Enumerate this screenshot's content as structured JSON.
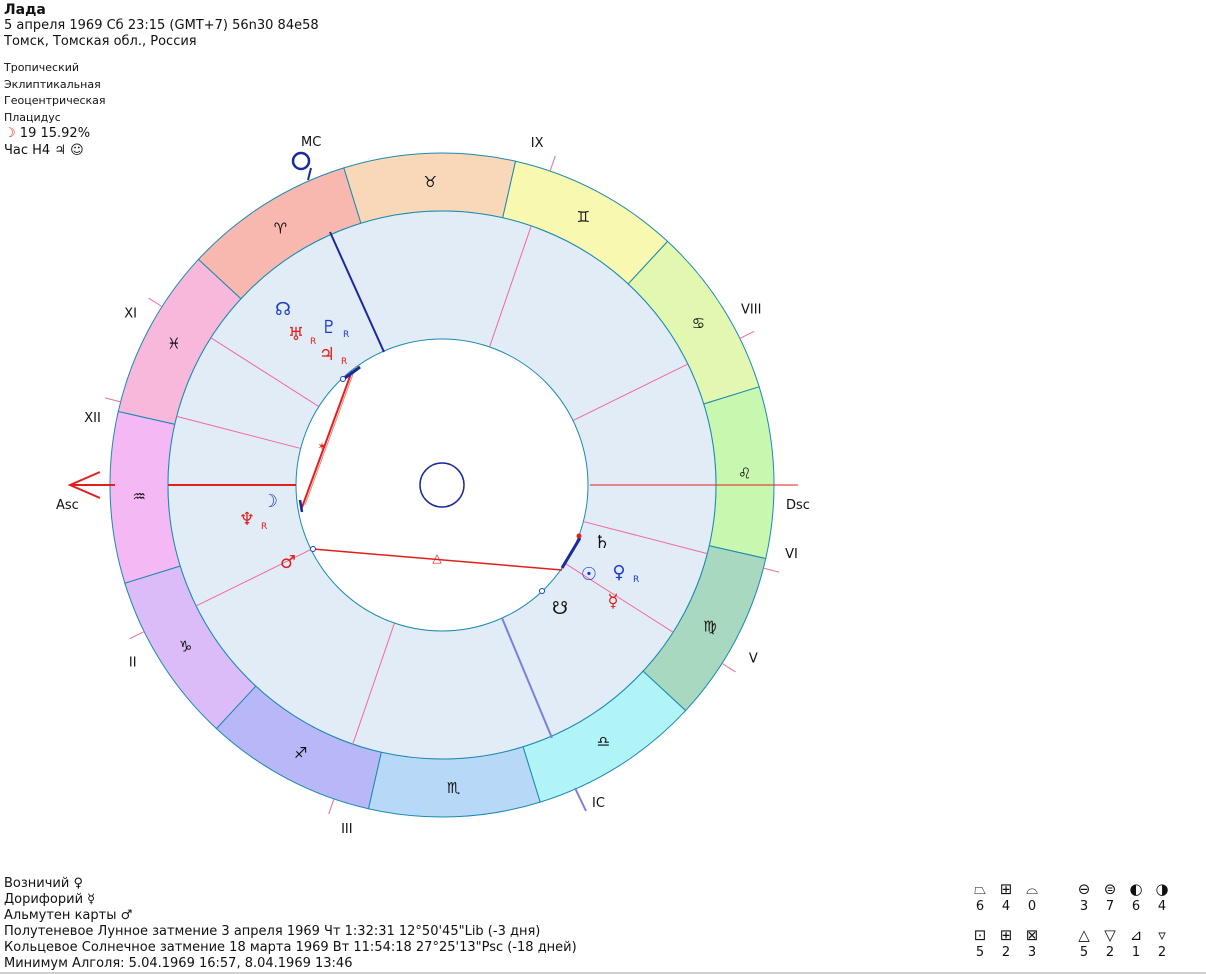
{
  "header": {
    "name": "Лада",
    "line1": "5 апреля 1969  Сб  23:15 (GMT+7) 56n30  84e58",
    "line2": "Томск, Томская обл., Россия"
  },
  "system": {
    "zodiac": "Тропический",
    "coords": "Эклиптикальная",
    "center": "Геоцентрическая",
    "houses": "Плацидус",
    "moon_glyph": "☽",
    "moon_info": "19 15.92%",
    "hour_label": "Час H4",
    "hour_glyphs": "♃ ☺"
  },
  "wheel": {
    "signs": [
      {
        "name": "aries",
        "glyph": "♈",
        "color": "#f8b8b0"
      },
      {
        "name": "taurus",
        "glyph": "♉",
        "color": "#f8d8b8"
      },
      {
        "name": "gemini",
        "glyph": "♊",
        "color": "#f8f8b0"
      },
      {
        "name": "cancer",
        "glyph": "♋",
        "color": "#e2f8b0"
      },
      {
        "name": "leo",
        "glyph": "♌",
        "color": "#c8f8b0"
      },
      {
        "name": "virgo",
        "glyph": "♍",
        "color": "#a8d8c0"
      },
      {
        "name": "libra",
        "glyph": "♎",
        "color": "#b0f4f8"
      },
      {
        "name": "scorpio",
        "glyph": "♏",
        "color": "#b8d8f8"
      },
      {
        "name": "sagittarius",
        "glyph": "♐",
        "color": "#b8b8f8"
      },
      {
        "name": "capricorn",
        "glyph": "♑",
        "color": "#dcbcf8"
      },
      {
        "name": "aquarius",
        "glyph": "♒",
        "color": "#f4b8f4"
      },
      {
        "name": "pisces",
        "glyph": "♓",
        "color": "#f8b8dc"
      }
    ],
    "angles": {
      "asc": "Asc",
      "dsc": "Dsc",
      "mc": "MC",
      "ic": "IC"
    },
    "houses": [
      {
        "label": "II",
        "deg": 206.2
      },
      {
        "label": "III",
        "deg": 251.0
      },
      {
        "label": "V",
        "deg": 327.5
      },
      {
        "label": "VI",
        "deg": 345.5
      },
      {
        "label": "VIII",
        "deg": 26.2
      },
      {
        "label": "IX",
        "deg": 71.0
      },
      {
        "label": "XI",
        "deg": 147.5
      },
      {
        "label": "XII",
        "deg": 165.5
      }
    ],
    "planets": [
      {
        "name": "uranus",
        "glyph": "♅",
        "retro": "R",
        "color": "#e0201c"
      },
      {
        "name": "pluto",
        "glyph": "♇",
        "retro": "R",
        "color": "#1a3ccc"
      },
      {
        "name": "jupiter",
        "glyph": "♃",
        "retro": "R",
        "color": "#e0201c"
      },
      {
        "name": "node-north",
        "glyph": "☊",
        "retro": "",
        "color": "#1a3ccc"
      },
      {
        "name": "moon",
        "glyph": "☽",
        "retro": "",
        "color": "#1a3ccc"
      },
      {
        "name": "neptune",
        "glyph": "♆",
        "retro": "R",
        "color": "#e0201c"
      },
      {
        "name": "mars",
        "glyph": "♂",
        "retro": "",
        "color": "#e0201c"
      },
      {
        "name": "saturn",
        "glyph": "♄",
        "retro": "",
        "color": "#111111"
      },
      {
        "name": "sun",
        "glyph": "☉",
        "retro": "",
        "color": "#1a3ccc"
      },
      {
        "name": "venus",
        "glyph": "♀",
        "retro": "R",
        "color": "#1a3ccc"
      },
      {
        "name": "mercury",
        "glyph": "☿",
        "retro": "",
        "color": "#e0201c"
      },
      {
        "name": "node-south",
        "glyph": "☋",
        "retro": "",
        "color": "#111111"
      }
    ],
    "aspect_glyphs": {
      "trine": "△",
      "sextile": "✶"
    }
  },
  "footer": {
    "l1": "Возничий  ♀",
    "l2": "Дорифорий  ☿",
    "l3": "Альмутен карты  ♂",
    "l4": "Полутеневое Лунное затмение 3 апреля 1969 Чт  1:32:31 12°50'45\"Lib (-3 дня)",
    "l5": "Кольцевое Солнечное затмение 18 марта 1969 Вт 11:54:18 27°25'13\"Psc (-18 дней)",
    "l6": "Минимум Алголя: 5.04.1969 16:57,  8.04.1969 13:46"
  },
  "stats": [
    {
      "g": "⏢",
      "v": "6"
    },
    {
      "g": "⊞",
      "v": "4"
    },
    {
      "g": "⌓",
      "v": "0"
    },
    {
      "g": "⊖",
      "v": "3"
    },
    {
      "g": "⊜",
      "v": "7"
    },
    {
      "g": "◐",
      "v": "6"
    },
    {
      "g": "◑",
      "v": "4"
    },
    {
      "g": "⊡",
      "v": "5"
    },
    {
      "g": "⊞",
      "v": "2"
    },
    {
      "g": "⊠",
      "v": "3"
    },
    {
      "g": "△",
      "v": "5"
    },
    {
      "g": "▽",
      "v": "2"
    },
    {
      "g": "⊿",
      "v": "1"
    },
    {
      "g": "▿",
      "v": "2"
    }
  ]
}
